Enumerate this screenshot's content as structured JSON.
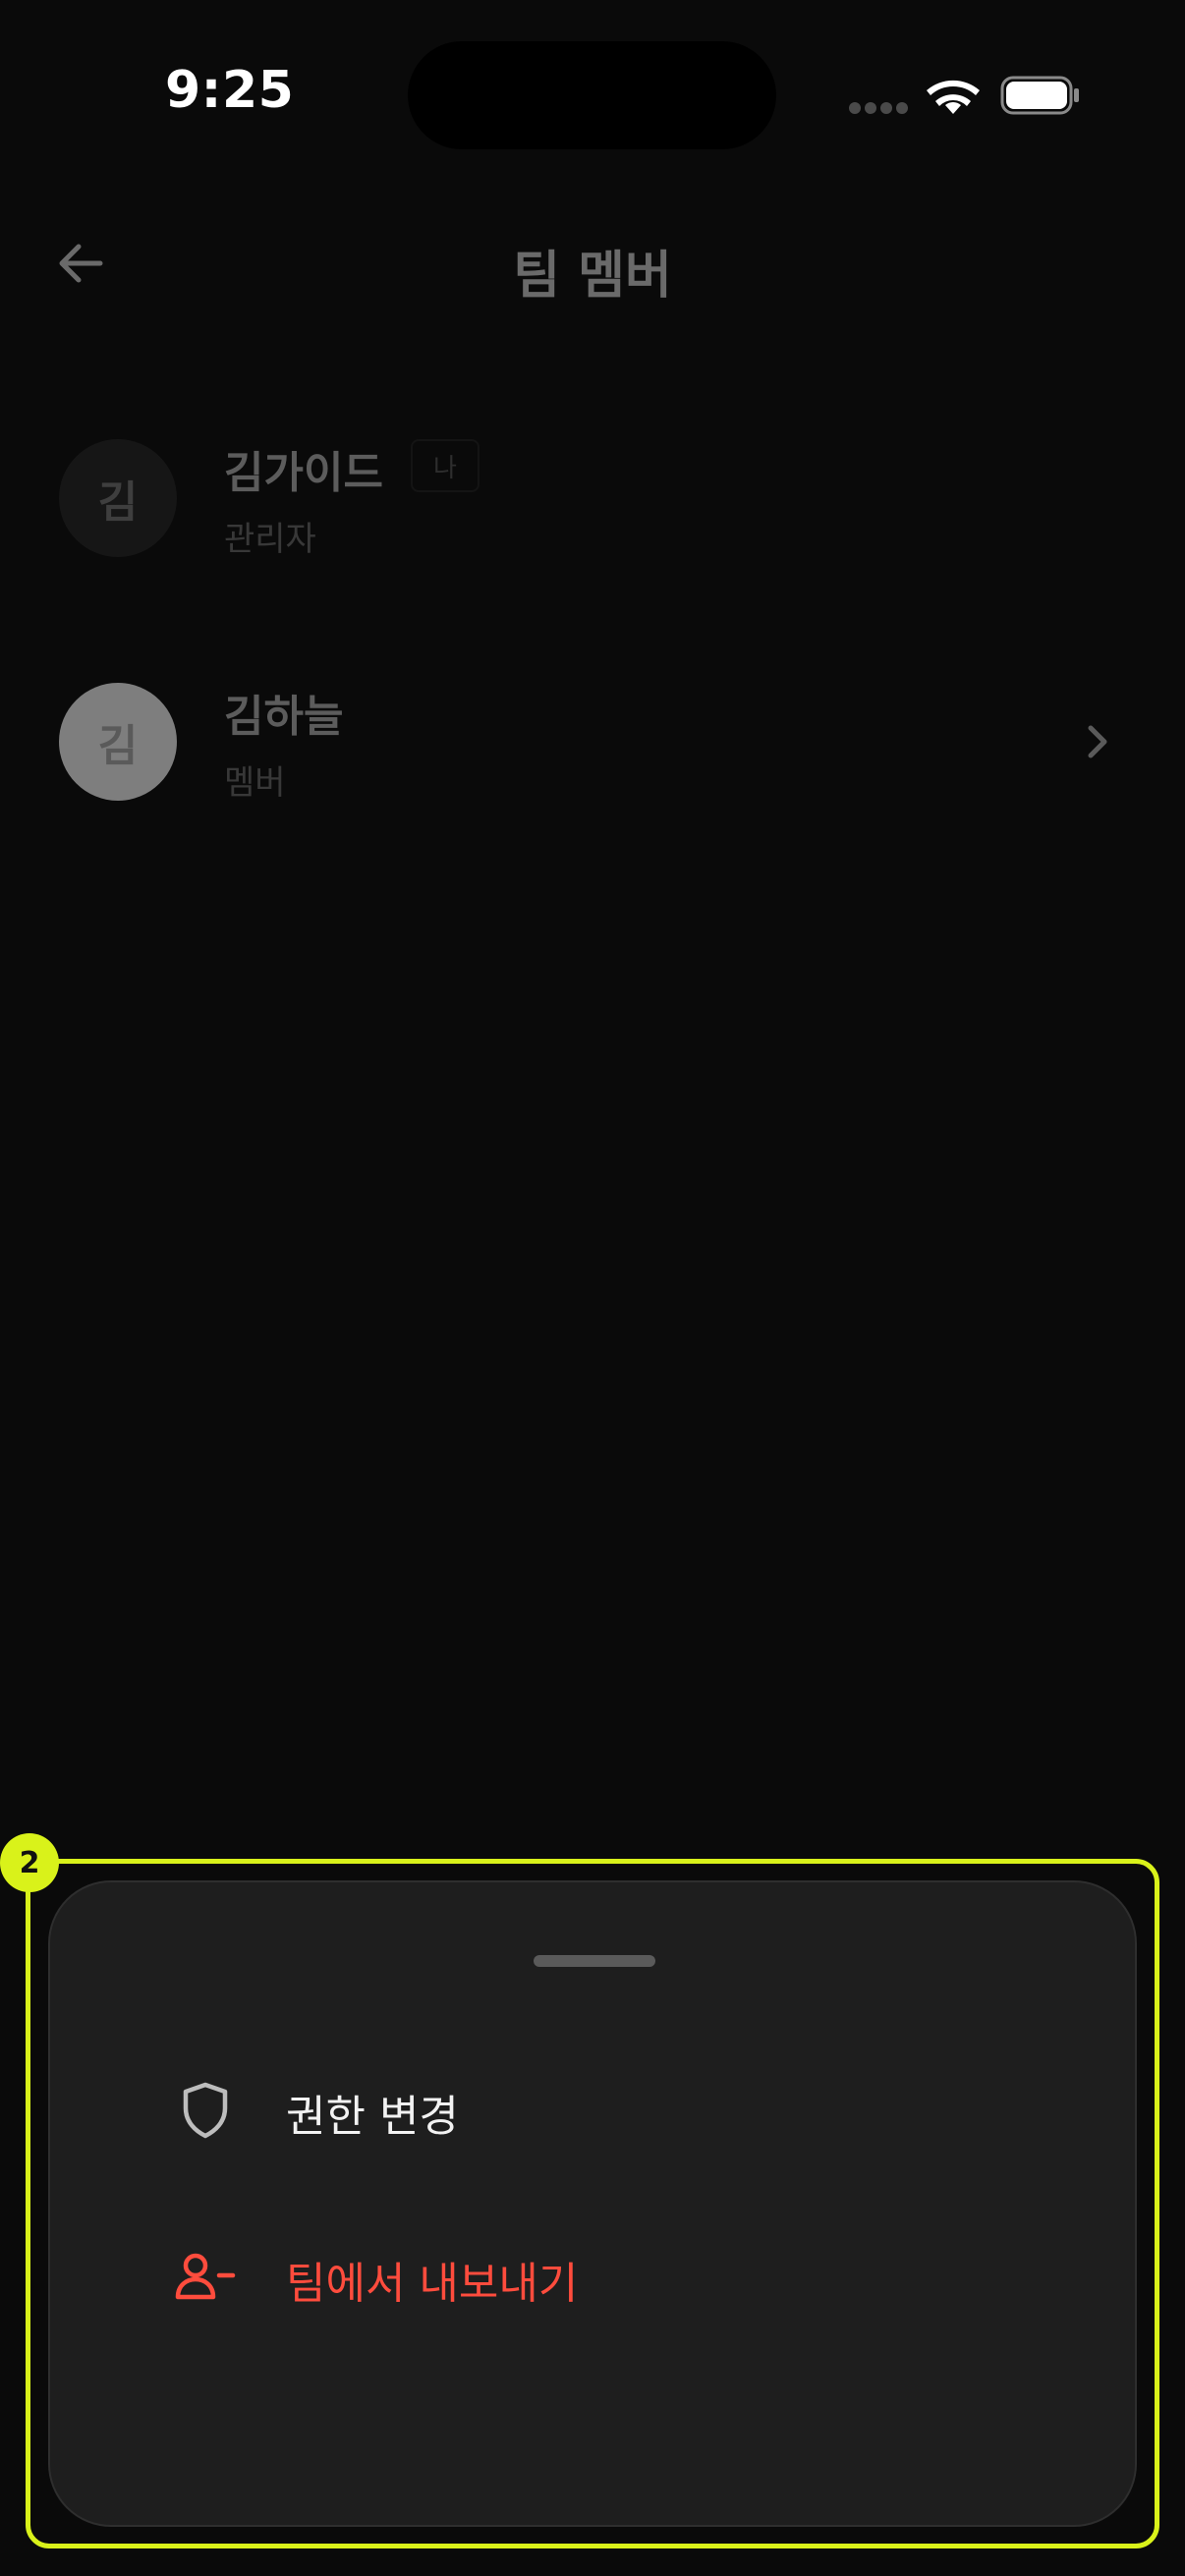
{
  "status_bar": {
    "time": "9:25"
  },
  "header": {
    "back_icon": "arrow-left-icon",
    "title": "팀 멤버"
  },
  "members": [
    {
      "avatar_initial": "김",
      "name": "김가이드",
      "badge": "나",
      "role": "관리자",
      "avatar_color": "#161616"
    },
    {
      "avatar_initial": "김",
      "name": "김하늘",
      "role": "멤버",
      "avatar_color": "#7e7e7e",
      "trailing_icon": "chevron-right-icon"
    }
  ],
  "highlight": {
    "number": "2",
    "color": "#d9f21a"
  },
  "action_sheet": {
    "items": [
      {
        "icon": "shield-icon",
        "label": "권한 변경",
        "color": "#f2f2f2"
      },
      {
        "icon": "user-minus-icon",
        "label": "팀에서 내보내기",
        "color": "#ff4c3d"
      }
    ]
  }
}
